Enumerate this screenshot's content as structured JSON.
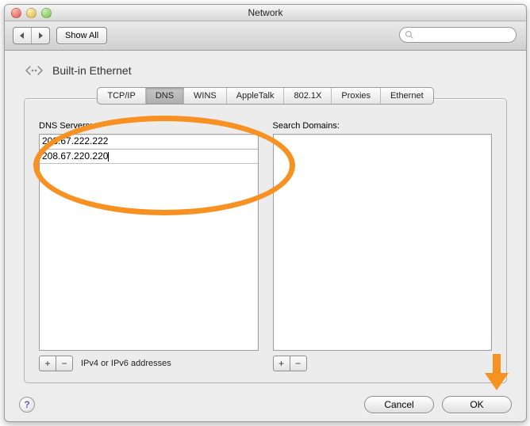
{
  "window": {
    "title": "Network"
  },
  "toolbar": {
    "show_all": "Show All"
  },
  "header": {
    "title": "Built-in Ethernet"
  },
  "tabs": {
    "items": [
      "TCP/IP",
      "DNS",
      "WINS",
      "AppleTalk",
      "802.1X",
      "Proxies",
      "Ethernet"
    ],
    "selected": "DNS"
  },
  "dns": {
    "label": "DNS Servers:",
    "rows": [
      "208.67.222.222",
      "208.67.220.220"
    ],
    "hint": "IPv4 or IPv6 addresses",
    "add": "+",
    "remove": "−"
  },
  "search_domains": {
    "label": "Search Domains:",
    "rows": [],
    "add": "+",
    "remove": "−"
  },
  "footer": {
    "help": "?",
    "cancel": "Cancel",
    "ok": "OK"
  }
}
